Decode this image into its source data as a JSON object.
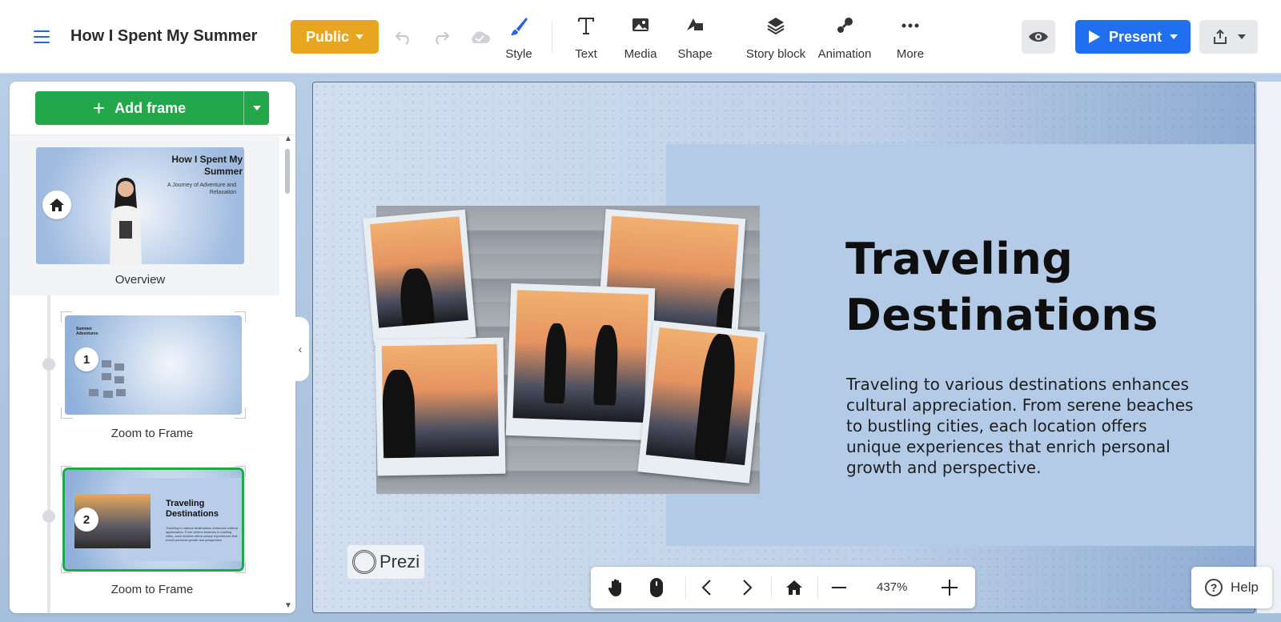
{
  "toolbar": {
    "title": "How I Spent My Summer",
    "public_label": "Public",
    "tools": {
      "style": "Style",
      "text": "Text",
      "media": "Media",
      "shape": "Shape",
      "story_block": "Story block",
      "animation": "Animation",
      "more": "More"
    },
    "present_label": "Present"
  },
  "sidebar": {
    "add_frame_label": "Add frame",
    "overview": {
      "label": "Overview",
      "thumb_title": "How I Spent My Summer",
      "thumb_subtitle": "A Journey of Adventure and Relaxation"
    },
    "frames": [
      {
        "number": "1",
        "label": "Zoom to Frame",
        "thumb_title": "Summer Adventures"
      },
      {
        "number": "2",
        "label": "Zoom to Frame",
        "thumb_title": "Traveling Destinations",
        "thumb_text": "Traveling to various destinations enhances cultural appreciation. From serene beaches to bustling cities, each location offers unique experiences that enrich personal growth and perspective."
      }
    ]
  },
  "canvas": {
    "heading_line1": "Traveling",
    "heading_line2": "Destinations",
    "body": "Traveling to various destinations enhances cultural appreciation. From serene beaches to bustling cities, each location offers unique experiences that enrich personal growth and perspective.",
    "logo_text": "Prezi"
  },
  "bottombar": {
    "zoom": "437%"
  },
  "help_label": "Help",
  "colors": {
    "public": "#e8a620",
    "present": "#1f6ff0",
    "add_frame": "#23a74b",
    "slide_panel": "#b4cbe8"
  }
}
